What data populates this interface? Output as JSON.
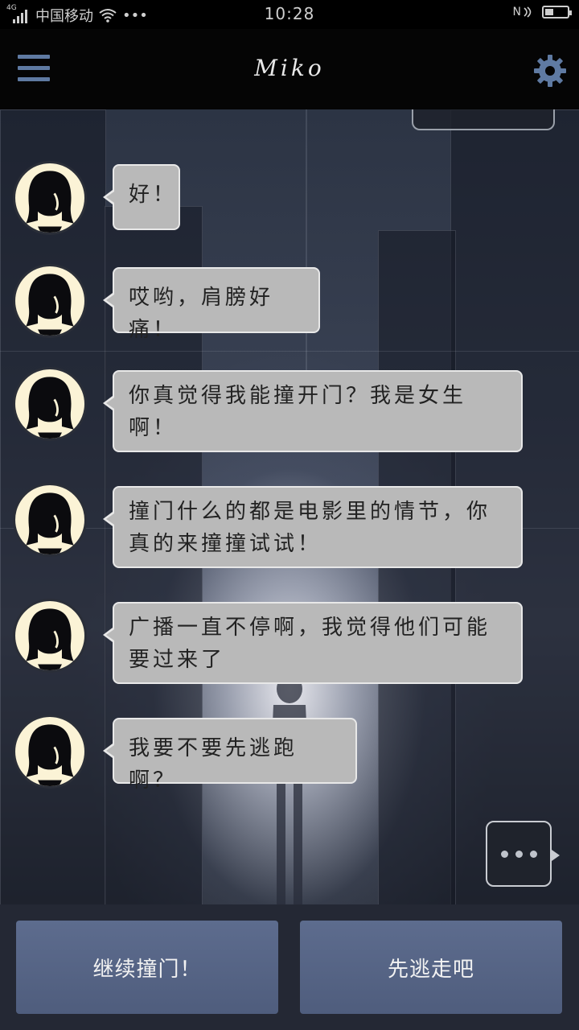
{
  "status_bar": {
    "network": "4G",
    "carrier": "中国移动",
    "extra": "•••",
    "time": "10:28",
    "nfc": "N",
    "battery_level": 0.4
  },
  "header": {
    "title": "Miko",
    "menu_icon": "hamburger-menu-icon",
    "settings_icon": "gear-icon",
    "accent_color": "#5f7aa2"
  },
  "messages": [
    {
      "sender": "Miko",
      "text": "好！"
    },
    {
      "sender": "Miko",
      "text": "哎哟，肩膀好痛！"
    },
    {
      "sender": "Miko",
      "text": "你真觉得我能撞开门？我是女生啊！"
    },
    {
      "sender": "Miko",
      "text": "撞门什么的都是电影里的情节，你真的来撞撞试试！"
    },
    {
      "sender": "Miko",
      "text": "广播一直不停啊，我觉得他们可能要过来了"
    },
    {
      "sender": "Miko",
      "text": "我要不要先逃跑啊？"
    }
  ],
  "typing_indicator": "•••",
  "choices": [
    {
      "label": "继续撞门！"
    },
    {
      "label": "先逃走吧"
    }
  ]
}
